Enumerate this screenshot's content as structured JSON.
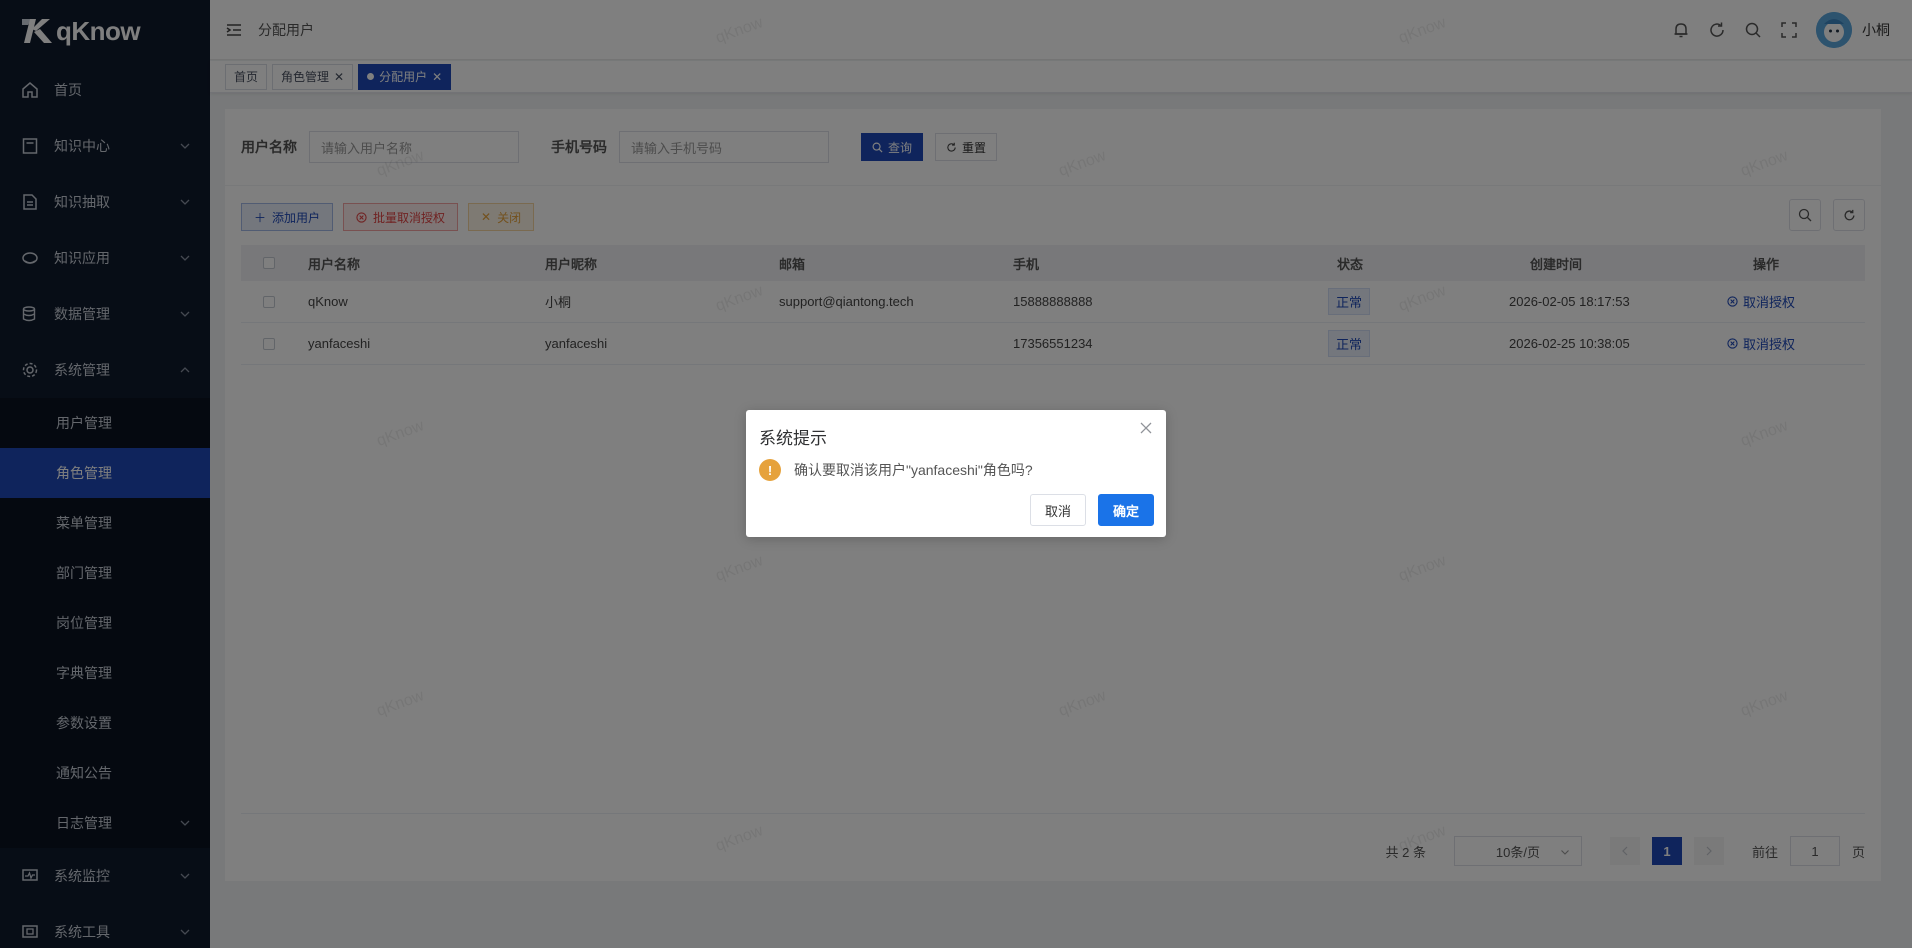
{
  "sidebar": {
    "logo": "qKnow",
    "items": [
      {
        "label": "首页",
        "icon": "home-icon"
      },
      {
        "label": "知识中心",
        "icon": "book-icon"
      },
      {
        "label": "知识抽取",
        "icon": "document-icon"
      },
      {
        "label": "知识应用",
        "icon": "app-icon"
      },
      {
        "label": "数据管理",
        "icon": "database-icon"
      },
      {
        "label": "系统管理",
        "icon": "gear-icon"
      }
    ],
    "sub_items": [
      {
        "label": "用户管理"
      },
      {
        "label": "角色管理"
      },
      {
        "label": "菜单管理"
      },
      {
        "label": "部门管理"
      },
      {
        "label": "岗位管理"
      },
      {
        "label": "字典管理"
      },
      {
        "label": "参数设置"
      },
      {
        "label": "通知公告"
      },
      {
        "label": "日志管理"
      }
    ],
    "bottom_items": [
      {
        "label": "系统监控",
        "icon": "monitor-icon"
      },
      {
        "label": "系统工具",
        "icon": "tool-icon"
      }
    ]
  },
  "header": {
    "breadcrumb": "分配用户",
    "user_name": "小桐"
  },
  "tags": [
    {
      "label": "首页"
    },
    {
      "label": "角色管理"
    },
    {
      "label": "分配用户"
    }
  ],
  "search": {
    "username_label": "用户名称",
    "username_placeholder": "请输入用户名称",
    "phone_label": "手机号码",
    "phone_placeholder": "请输入手机号码",
    "query_label": "查询",
    "reset_label": "重置"
  },
  "toolbar": {
    "add_label": "添加用户",
    "batch_cancel_label": "批量取消授权",
    "close_label": "关闭"
  },
  "table": {
    "columns": [
      "用户名称",
      "用户昵称",
      "邮箱",
      "手机",
      "状态",
      "创建时间",
      "操作"
    ],
    "rows": [
      {
        "username": "qKnow",
        "nickname": "小桐",
        "email": "support@qiantong.tech",
        "phone": "15888888888",
        "status": "正常",
        "created": "2026-02-05 18:17:53",
        "action": "取消授权"
      },
      {
        "username": "yanfaceshi",
        "nickname": "yanfaceshi",
        "email": "",
        "phone": "17356551234",
        "status": "正常",
        "created": "2026-02-25 10:38:05",
        "action": "取消授权"
      }
    ]
  },
  "pagination": {
    "total_text": "共 2 条",
    "page_size": "10条/页",
    "current_page": "1",
    "goto_prefix": "前往",
    "goto_value": "1",
    "goto_suffix": "页"
  },
  "dialog": {
    "title": "系统提示",
    "message": "确认要取消该用户\"yanfaceshi\"角色吗?",
    "cancel_label": "取消",
    "confirm_label": "确定"
  },
  "watermark": "qKnow",
  "colors": {
    "sidebar_bg": "#0f1a2c",
    "primary": "#1f49b8",
    "dialog_confirm": "#1a73e8",
    "warning": "#e6a23c",
    "danger": "#e04545"
  }
}
